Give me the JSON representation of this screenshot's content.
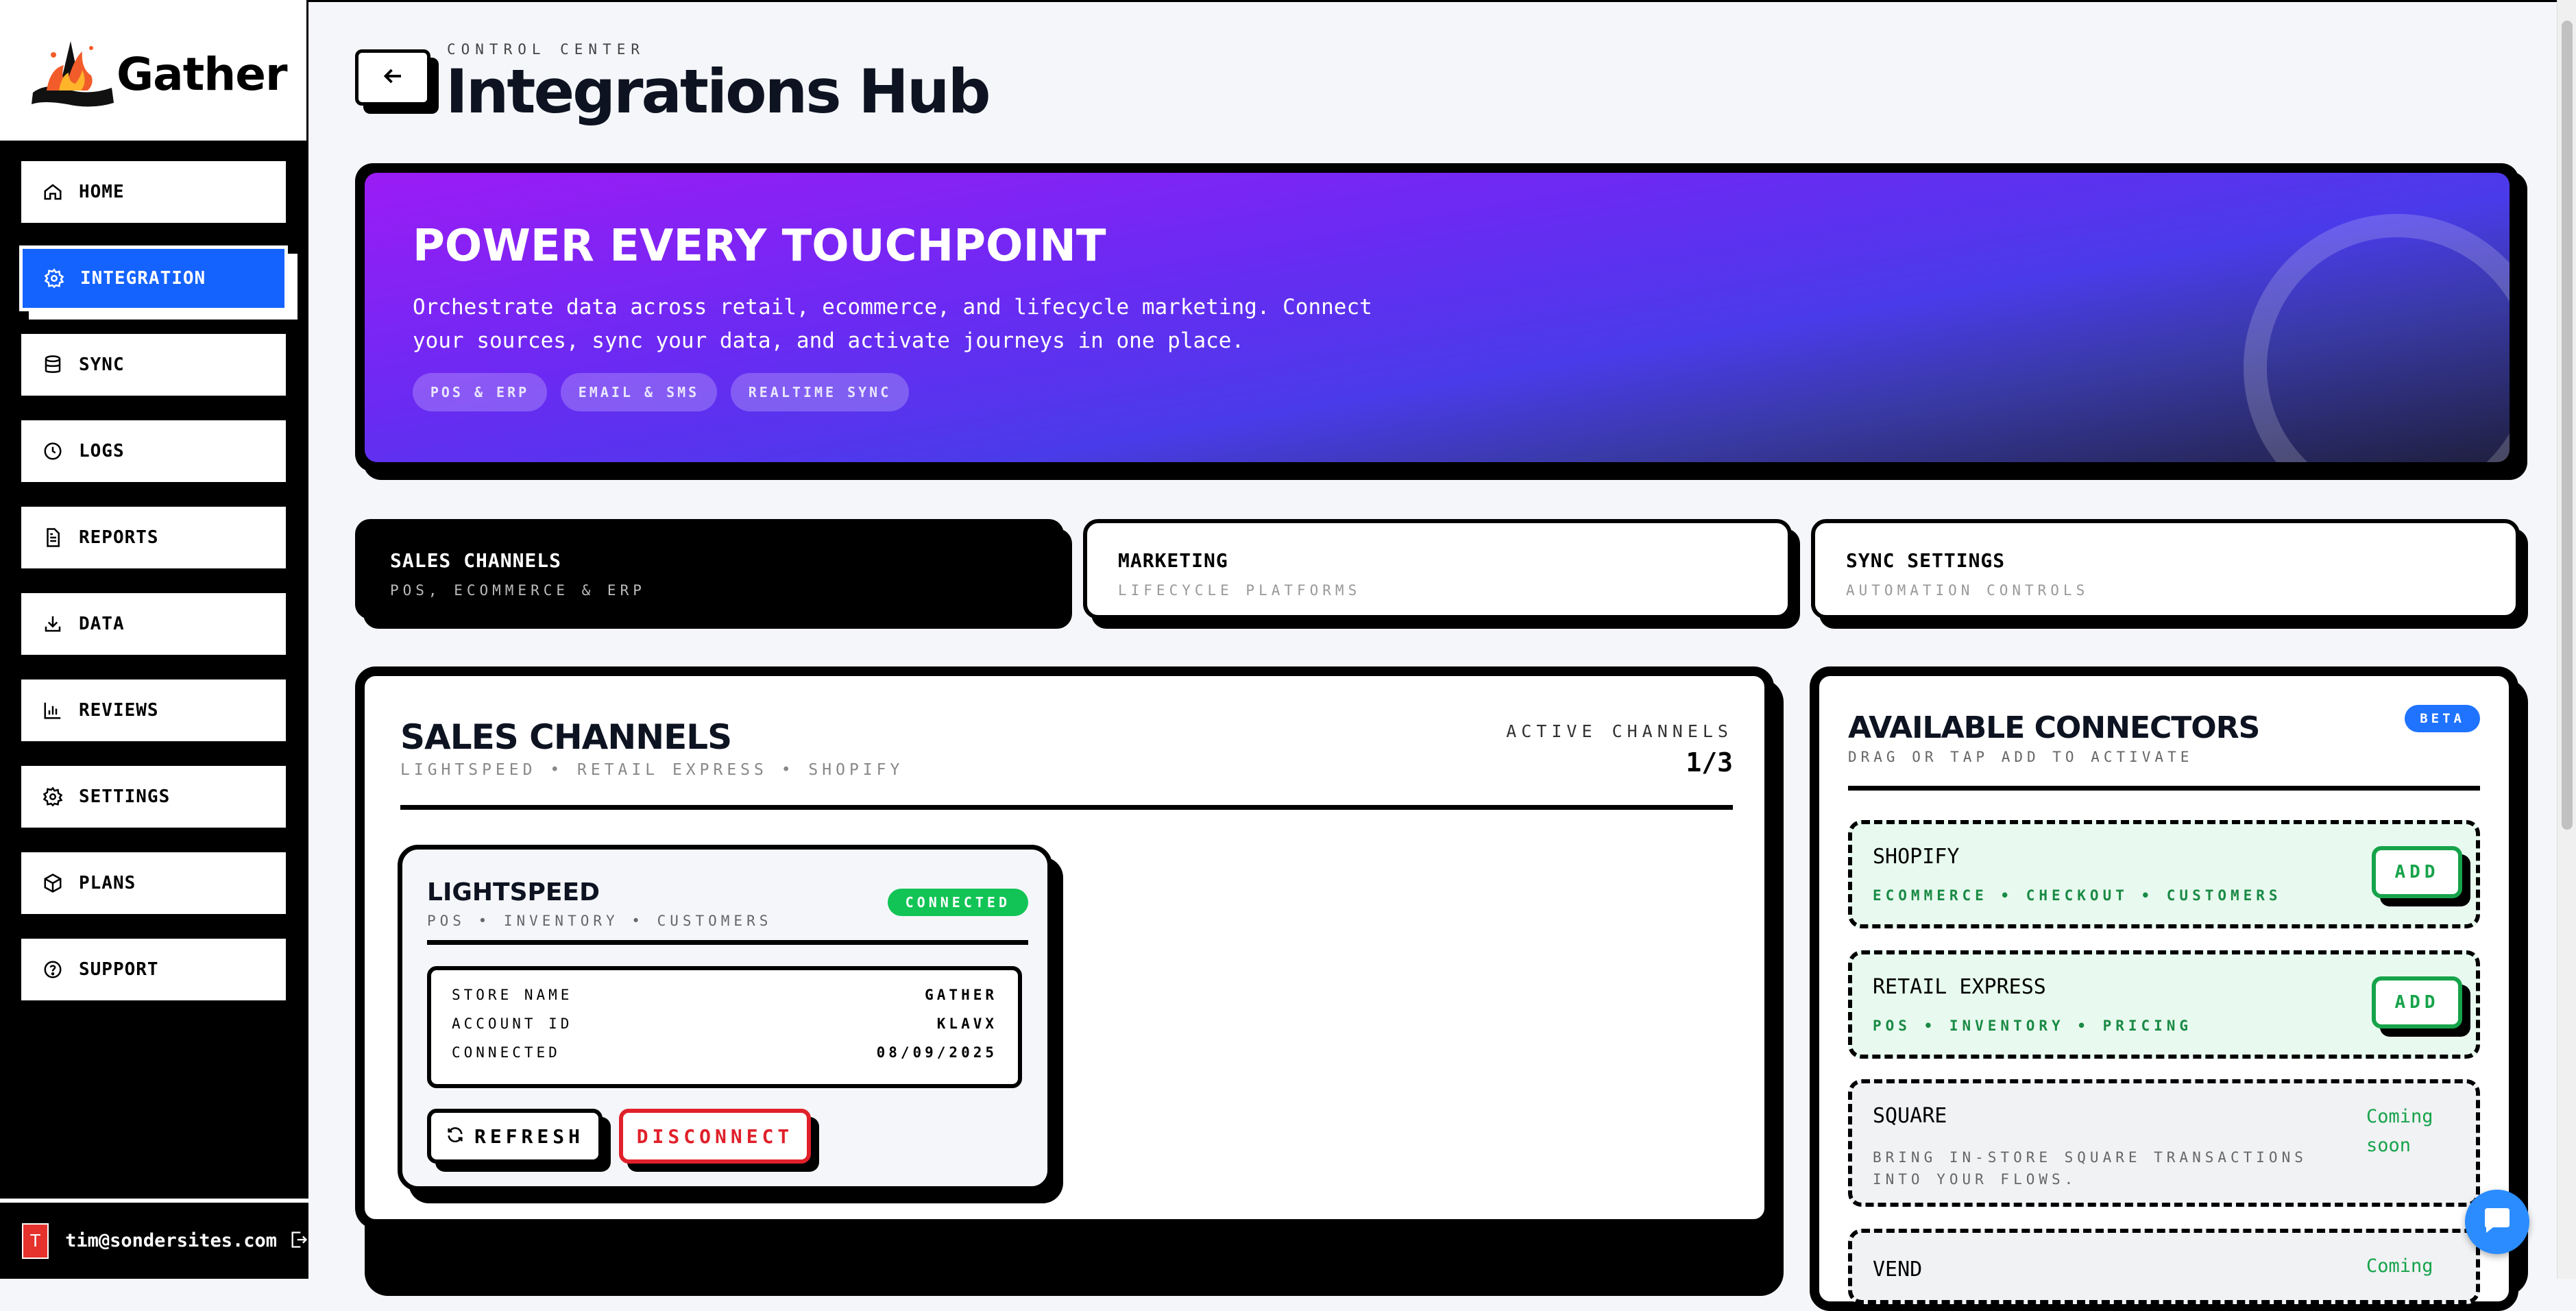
{
  "brand": {
    "name": "Gather",
    "logo_icon": "bonfire-logo"
  },
  "sidebar": {
    "items": [
      {
        "label": "HOME",
        "icon": "home-icon"
      },
      {
        "label": "INTEGRATION",
        "icon": "gear-icon",
        "active": true
      },
      {
        "label": "SYNC",
        "icon": "database-icon"
      },
      {
        "label": "LOGS",
        "icon": "clock-icon"
      },
      {
        "label": "REPORTS",
        "icon": "document-icon"
      },
      {
        "label": "DATA",
        "icon": "download-icon"
      },
      {
        "label": "REVIEWS",
        "icon": "bar-chart-icon"
      },
      {
        "label": "SETTINGS",
        "icon": "gear-icon"
      },
      {
        "label": "PLANS",
        "icon": "package-icon"
      },
      {
        "label": "SUPPORT",
        "icon": "help-circle-icon"
      }
    ],
    "user": {
      "avatar_letter": "T",
      "email": "tim@sondersites.com"
    }
  },
  "header": {
    "eyebrow": "CONTROL CENTER",
    "title": "Integrations Hub"
  },
  "hero": {
    "title": "POWER EVERY TOUCHPOINT",
    "description": "Orchestrate data across retail, ecommerce, and lifecycle marketing. Connect your sources, sync your data, and activate journeys in one place.",
    "chips": [
      "POS & ERP",
      "EMAIL & SMS",
      "REALTIME SYNC"
    ]
  },
  "tabs": [
    {
      "title": "SALES CHANNELS",
      "subtitle": "POS, ECOMMERCE & ERP",
      "active": true
    },
    {
      "title": "MARKETING",
      "subtitle": "LIFECYCLE PLATFORMS",
      "active": false
    },
    {
      "title": "SYNC SETTINGS",
      "subtitle": "AUTOMATION CONTROLS",
      "active": false
    }
  ],
  "sales_channels": {
    "title": "SALES CHANNELS",
    "subtitle": "LIGHTSPEED • RETAIL EXPRESS • SHOPIFY",
    "active_label": "ACTIVE CHANNELS",
    "active_count": "1/3",
    "card": {
      "title": "LIGHTSPEED",
      "subtitle": "POS • INVENTORY • CUSTOMERS",
      "status": "CONNECTED",
      "rows": [
        {
          "key": "STORE NAME",
          "value": "GATHER"
        },
        {
          "key": "ACCOUNT ID",
          "value": "KLAVX"
        },
        {
          "key": "CONNECTED",
          "value": "08/09/2025"
        }
      ],
      "refresh_label": "REFRESH",
      "disconnect_label": "DISCONNECT"
    }
  },
  "connectors": {
    "title": "AVAILABLE CONNECTORS",
    "subtitle": "DRAG OR TAP ADD TO ACTIVATE",
    "badge": "BETA",
    "items": [
      {
        "name": "SHOPIFY",
        "subtitle": "ECOMMERCE • CHECKOUT • CUSTOMERS",
        "action": "ADD"
      },
      {
        "name": "RETAIL EXPRESS",
        "subtitle": "POS • INVENTORY • PRICING",
        "action": "ADD"
      },
      {
        "name": "SQUARE",
        "subtitle": "BRING IN-STORE SQUARE TRANSACTIONS INTO YOUR FLOWS.",
        "status": "Coming soon"
      },
      {
        "name": "VEND",
        "status": "Coming"
      }
    ]
  },
  "colors": {
    "accent": "#1563ff",
    "success": "#11c455",
    "danger": "#e0202a",
    "beta": "#1f73ff"
  }
}
